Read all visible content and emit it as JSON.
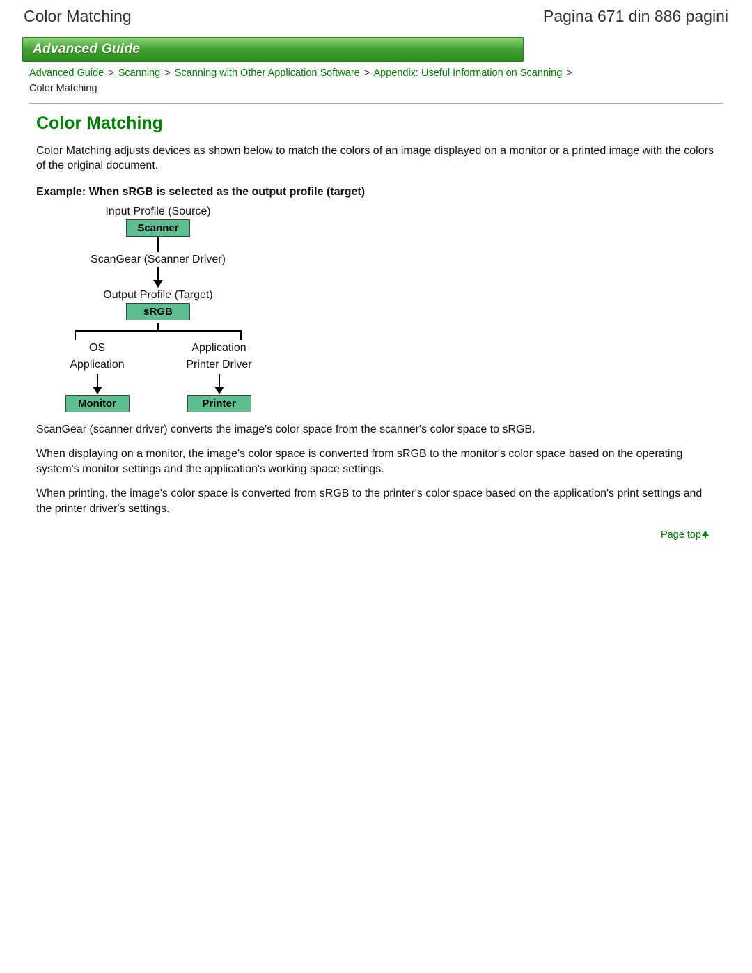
{
  "header": {
    "left": "Color Matching",
    "right": "Pagina 671 din 886 pagini"
  },
  "banner": "Advanced Guide",
  "breadcrumb": {
    "items": [
      "Advanced Guide",
      "Scanning",
      "Scanning with Other Application Software",
      "Appendix: Useful Information on Scanning"
    ],
    "current": "Color Matching",
    "sep": ">"
  },
  "title": "Color Matching",
  "intro": "Color Matching adjusts devices as shown below to match the colors of an image displayed on a monitor or a printed image with the colors of the original document.",
  "example_heading": "Example: When sRGB is selected as the output profile (target)",
  "diagram": {
    "input_label": "Input Profile (Source)",
    "scanner_box": "Scanner",
    "driver_label": "ScanGear (Scanner Driver)",
    "output_label": "Output Profile (Target)",
    "srgb_box": "sRGB",
    "left_path": {
      "line1": "OS",
      "line2": "Application",
      "box": "Monitor"
    },
    "right_path": {
      "line1": "Application",
      "line2": "Printer Driver",
      "box": "Printer"
    }
  },
  "paragraphs": [
    "ScanGear (scanner driver) converts the image's color space from the scanner's color space to sRGB.",
    "When displaying on a monitor, the image's color space is converted from sRGB to the monitor's color space based on the operating system's monitor settings and the application's working space settings.",
    "When printing, the image's color space is converted from sRGB to the printer's color space based on the application's print settings and the printer driver's settings."
  ],
  "pagetop": "Page top"
}
